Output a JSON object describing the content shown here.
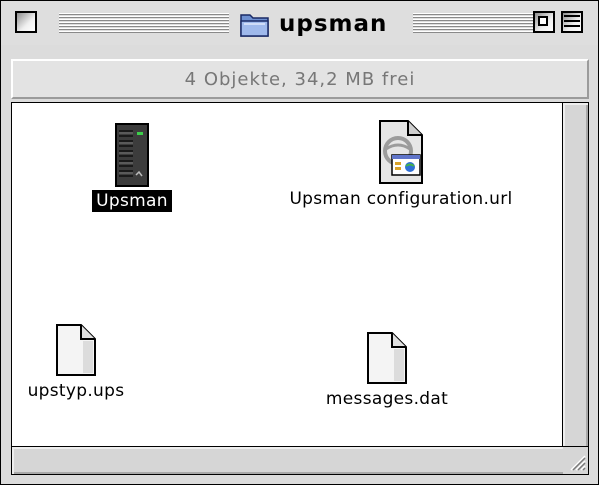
{
  "window": {
    "title": "upsman"
  },
  "infobar": {
    "text": "4 Objekte, 34,2 MB frei"
  },
  "items": [
    {
      "label": "Upsman",
      "icon": "server-application-icon",
      "selected": true
    },
    {
      "label": "Upsman configuration.url",
      "icon": "internet-location-file-icon",
      "selected": false
    },
    {
      "label": "upstyp.ups",
      "icon": "document-icon",
      "selected": false
    },
    {
      "label": "messages.dat",
      "icon": "document-icon",
      "selected": false
    }
  ],
  "colors": {
    "selection_bg": "#000000",
    "selection_fg": "#ffffff",
    "window_chrome": "#dcdcdc",
    "infobar_text": "#777777"
  }
}
